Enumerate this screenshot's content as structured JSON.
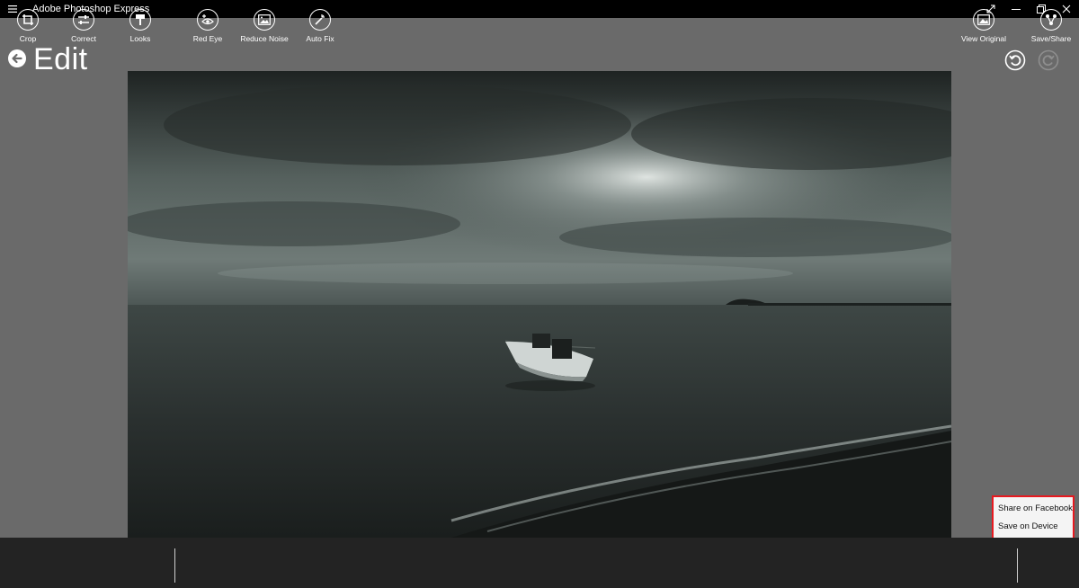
{
  "app": {
    "title": "Adobe Photoshop Express"
  },
  "header": {
    "title": "Edit"
  },
  "share_menu": {
    "items": [
      "Share on Facebook",
      "Save on Device"
    ]
  },
  "toolbar": {
    "tools": [
      {
        "label": "Crop",
        "icon": "crop-icon"
      },
      {
        "label": "Correct",
        "icon": "sliders-icon"
      },
      {
        "label": "Looks",
        "icon": "paint-roller-icon"
      },
      {
        "label": "Red Eye",
        "icon": "eye-plus-icon"
      },
      {
        "label": "Reduce Noise",
        "icon": "image-noise-icon"
      },
      {
        "label": "Auto Fix",
        "icon": "magic-wand-icon"
      }
    ],
    "right_tools": [
      {
        "label": "View Original",
        "icon": "image-icon"
      },
      {
        "label": "Save/Share",
        "icon": "share-icon"
      }
    ]
  },
  "colors": {
    "background": "#6a6a6a",
    "titlebar": "#000000",
    "toolbar": "#232323",
    "highlight": "#e8191f"
  }
}
